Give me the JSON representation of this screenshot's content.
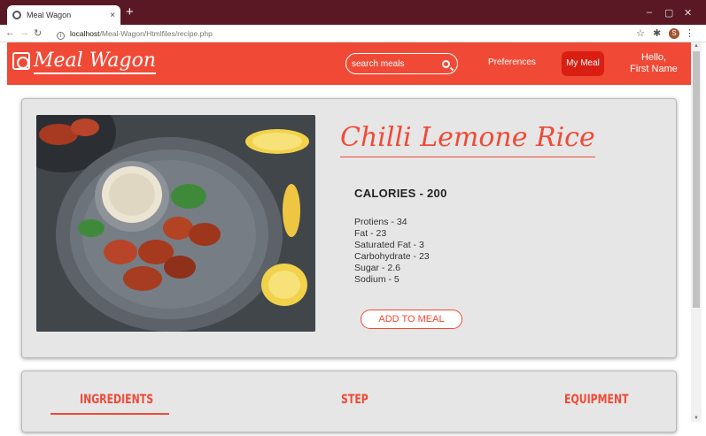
{
  "browser": {
    "tab_title": "Meal Wagon",
    "tab_close": "×",
    "new_tab": "+",
    "url_host": "localhost",
    "url_path": "/Meal-Wagon/Htmlfiles/recipe.php",
    "profile_initial": "S"
  },
  "header": {
    "logo": "Meal Wagon",
    "search_placeholder": "search meals",
    "preferences": "Preferences",
    "my_meal": "My Meal",
    "greeting_line1": "Hello,",
    "greeting_line2": "First Name"
  },
  "recipe": {
    "title": "Chilli Lemone Rice",
    "calories": "CALORIES - 200",
    "nutrients": [
      "Protiens - 34",
      "Fat - 23",
      "Saturated Fat - 3",
      "Carbohydrate - 23",
      "Sugar - 2.6",
      "Sodium - 5"
    ],
    "add_button": "ADD TO MEAL"
  },
  "sections": {
    "ingredients": "INGREDIENTS",
    "step": "STEP",
    "equipment": "EQUIPMENT"
  },
  "colors": {
    "accent": "#f04a36",
    "accent_dark": "#d91e12",
    "browser_frame": "#5a1824"
  }
}
